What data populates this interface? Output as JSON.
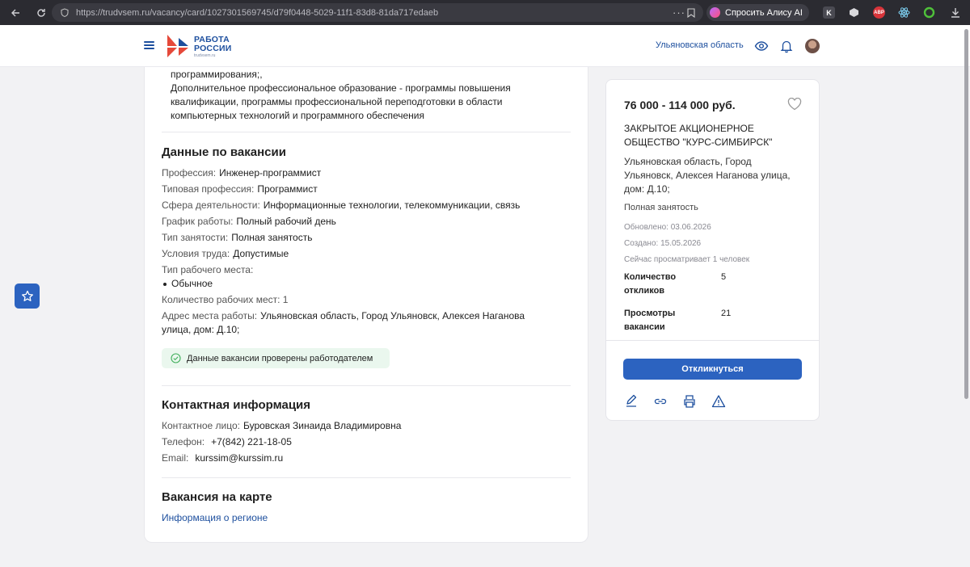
{
  "browser": {
    "url": "https://trudvsem.ru/vacancy/card/1027301569745/d79f0448-5029-11f1-83d8-81da717edaeb",
    "alice_label": "Спросить Алису AI",
    "ext_abp": "ABP"
  },
  "header": {
    "logo_line1": "РАБОТА",
    "logo_line2": "РОССИИ",
    "logo_domain": "trudvsem.ru",
    "region": "Ульяновская область"
  },
  "education": {
    "line1": "программирования;,",
    "line2": "Дополнительное профессиональное образование - программы повышения",
    "line3": "квалификации, программы профессиональной переподготовки в области",
    "line4": "компьютерных технологий и программного обеспечения"
  },
  "vacancy": {
    "title": "Данные по вакансии",
    "profession_k": "Профессия:",
    "profession_v": "Инженер-программист",
    "typical_k": "Типовая профессия:",
    "typical_v": "Программист",
    "sphere_k": "Сфера деятельности:",
    "sphere_v": "Информационные технологии, телекоммуникации, связь",
    "schedule_k": "График работы:",
    "schedule_v": "Полный рабочий день",
    "employment_k": "Тип занятости:",
    "employment_v": "Полная занятость",
    "conditions_k": "Условия труда:",
    "conditions_v": "Допустимые",
    "workplace_k": "Тип рабочего места:",
    "workplace_item": "Обычное",
    "places": "Количество рабочих мест: 1",
    "address_k": "Адрес места работы:",
    "address_v1": "Ульяновская область, Город Ульяновск, Алексея Наганова",
    "address_v2": "улица, дом: Д.10;",
    "verified": "Данные вакансии проверены работодателем"
  },
  "contacts": {
    "title": "Контактная информация",
    "person_k": "Контактное лицо:",
    "person_v": "Буровская Зинаида Владимировна",
    "phone_k": "Телефон:",
    "phone_v": "+7(842) 221-18-05",
    "email_k": "Email:",
    "email_v": "kurssim@kurssim.ru"
  },
  "map": {
    "title": "Вакансия на карте",
    "region_link": "Информация о регионе"
  },
  "side": {
    "salary": "76 000 - 114 000 руб.",
    "company_line1": "ЗАКРЫТОЕ АКЦИОНЕРНОЕ",
    "company_line2": "ОБЩЕСТВО \"КУРС-СИМБИРСК\"",
    "addr_line1": "Ульяновская область, Город",
    "addr_line2": "Ульяновск, Алексея Наганова улица,",
    "addr_line3": "дом: Д.10;",
    "employment": "Полная занятость",
    "updated": "Обновлено: 03.06.2026",
    "created": "Создано: 15.05.2026",
    "viewing": "Сейчас просматривает 1 человек",
    "responses_k1": "Количество",
    "responses_k2": "откликов",
    "responses_v": "5",
    "views_k1": "Просмотры",
    "views_k2": "вакансии",
    "views_v": "21",
    "respond_button": "Откликнуться"
  },
  "colors": {
    "brand_blue": "#1d4f9e",
    "button_blue": "#2c63c0",
    "logo_red": "#e5493a",
    "verified_bg": "#eaf7ee"
  }
}
